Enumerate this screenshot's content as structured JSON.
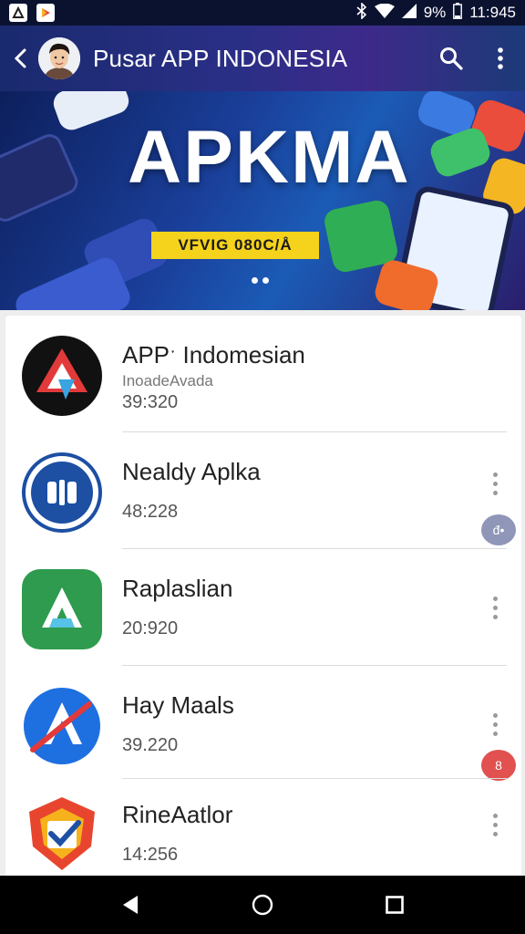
{
  "status_bar": {
    "battery": "9%",
    "time": "11:945"
  },
  "app_bar": {
    "title": "Pusar APP INDONESIA"
  },
  "banner": {
    "title": "APKMA",
    "tag": "VFVIG 080C/Å"
  },
  "apps": [
    {
      "name": "APPˑ Indomesian",
      "sub": "InoadeAvada",
      "count": "39:320"
    },
    {
      "name": "Nealdy Aplka",
      "count": "48:228",
      "badge": "đ•"
    },
    {
      "name": "Raplaslian",
      "count": "20:920"
    },
    {
      "name": "Hay Maals",
      "count": "39.220",
      "badge": "8"
    },
    {
      "name": "RineAatlor",
      "count": "14:256"
    }
  ],
  "colors": {
    "app_bar": "#2a2f86",
    "badge_gray": "#8f96b8",
    "badge_red": "#e0514f",
    "tag_yellow": "#f5d21c"
  },
  "icons": {
    "back": "back-arrow-icon",
    "search": "search-icon",
    "more": "more-vert-icon",
    "nav_back": "nav-back-icon",
    "nav_home": "nav-home-icon",
    "nav_recents": "nav-recents-icon"
  }
}
